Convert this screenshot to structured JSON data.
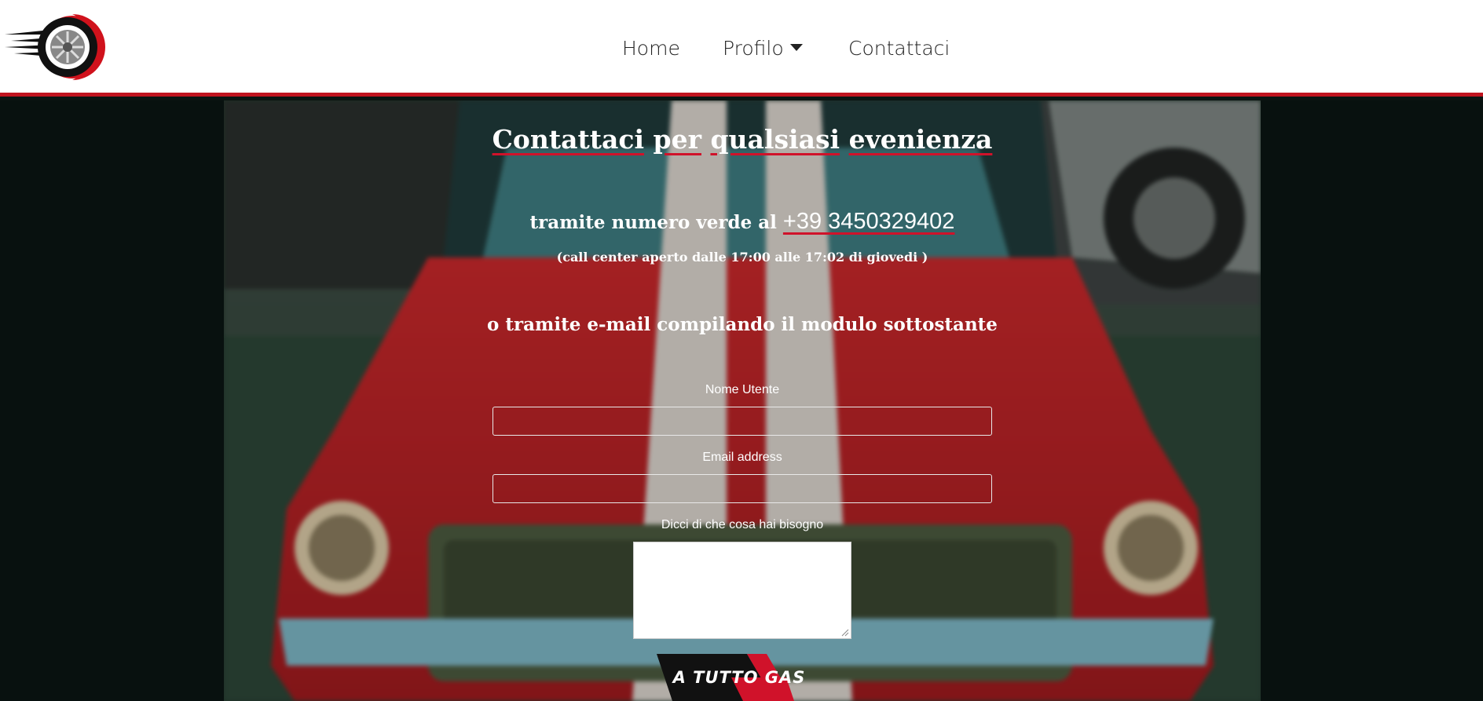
{
  "nav": {
    "logo_icon": "speeding-wheel-logo",
    "items": [
      {
        "label": "Home"
      },
      {
        "label": "Profilo"
      },
      {
        "label": "Contattaci"
      }
    ],
    "accent_color": "#c0141f"
  },
  "contact": {
    "title_words": [
      "Contattaci",
      "per",
      "qualsiasi",
      "evenienza"
    ],
    "phone_prefix": "tramite numero verde al ",
    "phone_number": "+39 3450329402",
    "hours": "(call center aperto dalle 17:00 alle 17:02 di giovedi )",
    "email_intro": "o tramite e-mail compilando il modulo sottostante"
  },
  "form": {
    "username_label": "Nome Utente",
    "email_label": "Email address",
    "message_label": "Dicci di che cosa hai bisogno",
    "submit_label": "A TUTTO GAS"
  }
}
